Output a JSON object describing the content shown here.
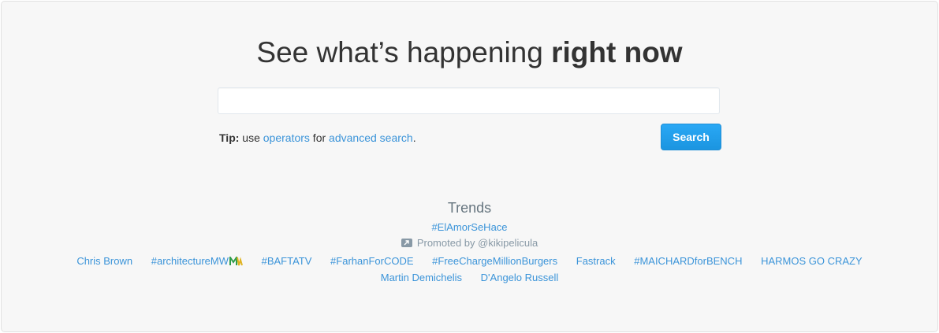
{
  "headline": {
    "normal": "See what’s happening ",
    "strong": "right now"
  },
  "search": {
    "value": "",
    "placeholder": "",
    "button_label": "Search"
  },
  "tip": {
    "label": "Tip:",
    "text_1": " use ",
    "operators_link": "operators",
    "text_2": " for ",
    "advanced_link": "advanced search",
    "text_3": "."
  },
  "trends": {
    "title": "Trends",
    "promoted_trend": "#ElAmorSeHace",
    "promoted_by": "Promoted by @kikipelicula",
    "row1": [
      "Chris Brown",
      "#architectureMW",
      "#BAFTATV",
      "#FarhanForCODE",
      "#FreeChargeMillionBurgers",
      "Fastrack",
      "#MAICHARDforBENCH",
      "HARMOS GO CRAZY"
    ],
    "row2": [
      "Martin Demichelis",
      "D'Angelo Russell"
    ]
  },
  "colors": {
    "link": "#3b94d9",
    "button": "#1da1f2",
    "panel_bg": "#f7f7f7",
    "muted": "#8899a6"
  },
  "icons": {
    "promoted": "promoted-arrow-icon",
    "architecture_logo": "mw-logo-icon"
  }
}
